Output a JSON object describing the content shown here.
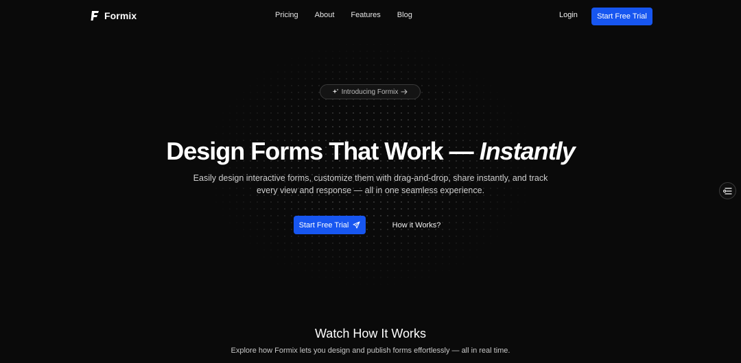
{
  "nav": {
    "brand": "Formix",
    "links": [
      "Pricing",
      "About",
      "Features",
      "Blog"
    ],
    "login": "Login",
    "cta": "Start Free Trial"
  },
  "badge": {
    "text": "Introducing Formix",
    "icons": [
      "sparkle-icon",
      "arrow-right-icon"
    ]
  },
  "hero": {
    "title_main": "Design Forms That Work —",
    "title_emphasis": "Instantly",
    "subtitle": "Easily design interactive forms, customize them with drag-and-drop, share instantly, and track every view and response — all in one seamless experience.",
    "primary_cta": "Start Free Trial",
    "primary_cta_icon": "send-icon",
    "secondary_cta": "How it Works?"
  },
  "floating_button": {
    "icon": "form-list-icon"
  },
  "watch": {
    "title": "Watch How It Works",
    "subtitle": "Explore how Formix lets you design and publish forms effortlessly — all in real time."
  },
  "colors": {
    "background": "#0a0a0a",
    "accent": "#1756f0",
    "text": "#ffffff",
    "muted": "#c8c8c8"
  }
}
